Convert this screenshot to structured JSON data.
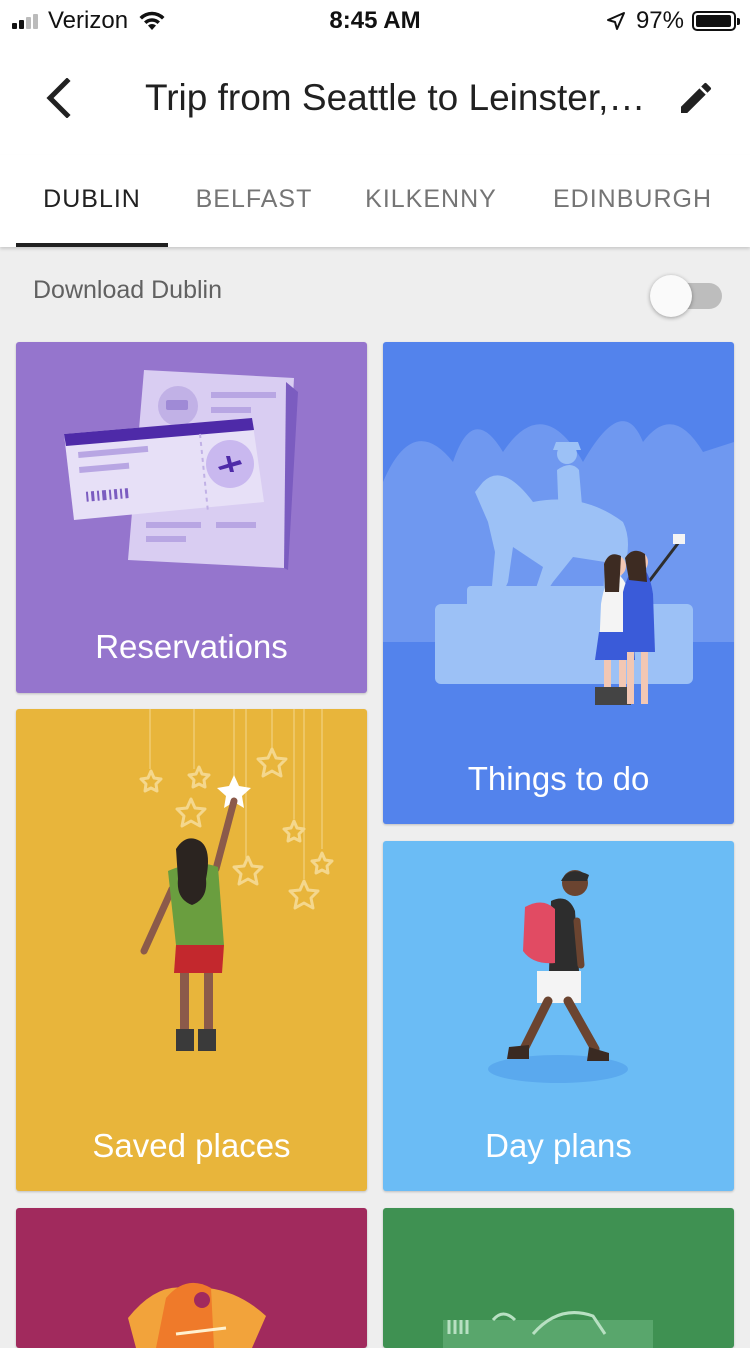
{
  "status_bar": {
    "carrier": "Verizon",
    "time": "8:45 AM",
    "battery": "97%",
    "battery_level": 0.97,
    "signal_bars": 4,
    "signal_bars_filled": 2
  },
  "header": {
    "title": "Trip from Seattle to Leinster, Ireland…",
    "back_icon": "back-arrow-icon",
    "edit_icon": "pencil-icon"
  },
  "tabs": [
    {
      "label": "DUBLIN",
      "active": true
    },
    {
      "label": "BELFAST",
      "active": false
    },
    {
      "label": "KILKENNY",
      "active": false
    },
    {
      "label": "EDINBURGH",
      "active": false
    }
  ],
  "download": {
    "label": "Download Dublin",
    "enabled": false
  },
  "cards": [
    {
      "label": "Reservations",
      "color": "#9575cd"
    },
    {
      "label": "Things to do",
      "color": "#5383ec"
    },
    {
      "label": "Saved places",
      "color": "#e8b53b"
    },
    {
      "label": "Day plans",
      "color": "#6bbcf5"
    },
    {
      "label": "",
      "color": "#a12a5d"
    },
    {
      "label": "",
      "color": "#3f9152"
    }
  ],
  "colors": {
    "background": "#eeeeee",
    "text_primary": "#212121",
    "text_secondary": "#757575"
  }
}
